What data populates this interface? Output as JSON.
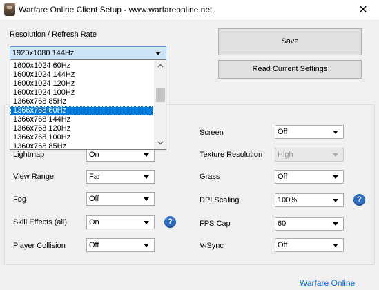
{
  "window": {
    "title": "Warfare Online Client Setup - www.warfareonline.net",
    "close_glyph": "✕"
  },
  "resolution": {
    "label": "Resolution / Refresh Rate",
    "selected": "1920x1080 144Hz",
    "options": [
      "1600x1024 60Hz",
      "1600x1024 144Hz",
      "1600x1024 120Hz",
      "1600x1024 100Hz",
      "1366x768 85Hz",
      "1366x768 60Hz",
      "1366x768 144Hz",
      "1366x768 120Hz",
      "1366x768 100Hz",
      "1360x768 85Hz"
    ],
    "highlighted_option": "1366x768 60Hz"
  },
  "buttons": {
    "save": "Save",
    "read_current": "Read Current Settings"
  },
  "settings_left": [
    {
      "label": "Lightmap",
      "value": "On"
    },
    {
      "label": "View Range",
      "value": "Far"
    },
    {
      "label": "Fog",
      "value": "Off"
    },
    {
      "label": "Skill Effects (all)",
      "value": "On",
      "help": "?"
    },
    {
      "label": "Player Collision",
      "value": "Off"
    }
  ],
  "settings_right": [
    {
      "label": "Screen",
      "value": "Off"
    },
    {
      "label": "Texture Resolution",
      "value": "High",
      "disabled": true
    },
    {
      "label": "Grass",
      "value": "Off"
    },
    {
      "label": "DPI Scaling",
      "value": "100%",
      "help": "?"
    },
    {
      "label": "FPS Cap",
      "value": "60"
    },
    {
      "label": "V-Sync",
      "value": "Off"
    }
  ],
  "footer": {
    "link": "Warfare Online"
  },
  "icons": {
    "app": "warfare-online-app-icon",
    "help": "help-question-icon",
    "scroll_up": "chevron-up-icon",
    "scroll_down": "chevron-down-icon"
  },
  "colors": {
    "selection": "#0078d7",
    "link": "#0066cc",
    "help_icon": "#2f6ec0"
  }
}
